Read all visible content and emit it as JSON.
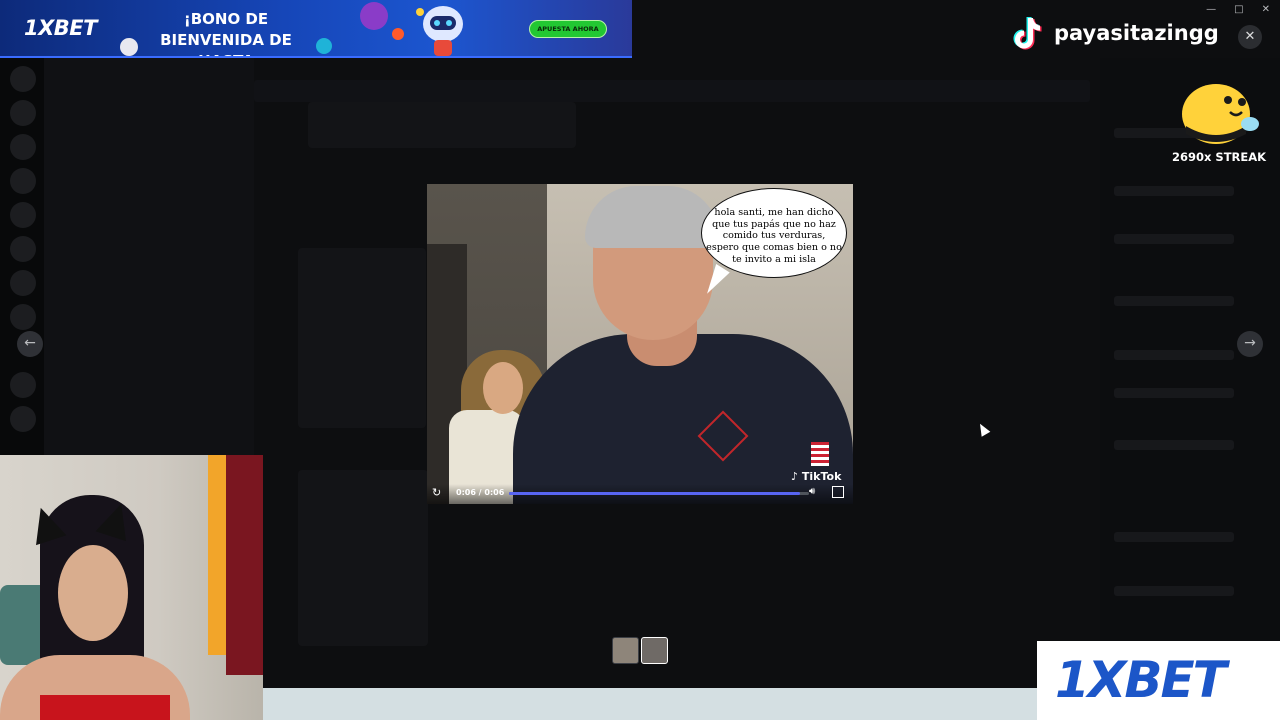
{
  "top_ad": {
    "logo": "1XBET",
    "headline": "¡BONO DE BIENVENIDA DE HASTA",
    "cta": "APUESTA AHORA"
  },
  "stream_overlay": {
    "tiktok_handle": "payasitazingg",
    "streak": "2690x STREAK",
    "tiktok_icon": "tiktok-logo-icon"
  },
  "viewer": {
    "close_label": "✕",
    "prev_label": "←",
    "next_label": "→",
    "speech_bubble": "hola santi, me han dicho que tus papás que no haz comido tus verduras, espero que comas bien o no te invito a mi isla",
    "watermark": "TikTok",
    "time": "0:06 / 0:06",
    "progress": 0.97,
    "thumbnail_count": 2
  },
  "window": {
    "controls": [
      "—",
      "□",
      "✕"
    ]
  },
  "bottom_ad": {
    "brand": "1XBET"
  },
  "colors": {
    "accent": "#5865f2",
    "ad_blue": "#1c56d0",
    "cta_green": "#22c832",
    "brand_blue": "#1c56c8"
  }
}
